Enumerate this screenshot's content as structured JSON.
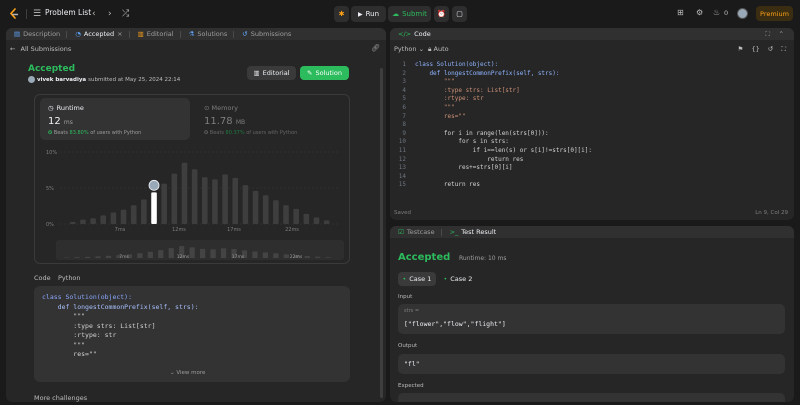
{
  "header": {
    "problem_list": "Problem List",
    "run": "Run",
    "submit": "Submit",
    "streak": "0",
    "premium": "Premium"
  },
  "left_tabs": [
    {
      "label": "Description"
    },
    {
      "label": "Accepted"
    },
    {
      "label": "Editorial"
    },
    {
      "label": "Solutions"
    },
    {
      "label": "Submissions"
    }
  ],
  "submission": {
    "back": "All Submissions",
    "status": "Accepted",
    "user": "vivek barvadiya",
    "submitted_at": "submitted at May 25, 2024 22:14",
    "editorial_btn": "Editorial",
    "solution_btn": "Solution"
  },
  "runtime": {
    "label": "Runtime",
    "value": "12",
    "unit": "ms",
    "beats_prefix": "Beats",
    "beats_pct": "83.80%",
    "beats_suffix": "of users with Python"
  },
  "memory": {
    "label": "Memory",
    "value": "11.78",
    "unit": "MB",
    "beats_prefix": "Beats",
    "beats_pct": "80.37%",
    "beats_suffix": "of users with Python"
  },
  "chart_data": {
    "type": "bar",
    "y_ticks": [
      "10%",
      "5%",
      "0%"
    ],
    "ylim": [
      0,
      10
    ],
    "x_ticks": [
      "7ms",
      "12ms",
      "17ms",
      "22ms"
    ],
    "mini_x_ticks": [
      "7ms",
      "12ms",
      "17ms",
      "22ms"
    ],
    "values": [
      0.3,
      0.6,
      0.8,
      1.2,
      1.6,
      2.0,
      2.6,
      3.4,
      4.4,
      5.6,
      7.0,
      8.5,
      7.6,
      6.5,
      6.2,
      6.9,
      6.4,
      5.4,
      4.6,
      4.0,
      3.3,
      2.6,
      2.1,
      1.4,
      0.9,
      0.5
    ],
    "highlight_index": 8
  },
  "code_view": {
    "code_label": "Code",
    "lang": "Python",
    "lines": [
      "class Solution(object):",
      "    def longestCommonPrefix(self, strs):",
      "        \"\"\"",
      "        :type strs: List[str]",
      "        :rtype: str",
      "        \"\"\"",
      "        res=\"\""
    ],
    "view_more": "View more",
    "more_challenges": "More challenges"
  },
  "code_panel": {
    "title": "Code",
    "lang": "Python",
    "auto": "Auto",
    "saved": "Saved",
    "cursor": "Ln 9, Col 29"
  },
  "editor_lines": [
    {
      "n": "1",
      "text": "class Solution(object):"
    },
    {
      "n": "2",
      "text": "    def longestCommonPrefix(self, strs):"
    },
    {
      "n": "3",
      "text": "        \"\"\""
    },
    {
      "n": "4",
      "text": "        :type strs: List[str]"
    },
    {
      "n": "5",
      "text": "        :rtype: str"
    },
    {
      "n": "6",
      "text": "        \"\"\""
    },
    {
      "n": "7",
      "text": "        res=\"\""
    },
    {
      "n": "8",
      "text": ""
    },
    {
      "n": "9",
      "text": "        for i in range(len(strs[0])):"
    },
    {
      "n": "10",
      "text": "            for s in strs:"
    },
    {
      "n": "11",
      "text": "                if i==len(s) or s[i]!=strs[0][i]:"
    },
    {
      "n": "12",
      "text": "                    return res"
    },
    {
      "n": "13",
      "text": "            res+=strs[0][i]"
    },
    {
      "n": "14",
      "text": ""
    },
    {
      "n": "15",
      "text": "        return res"
    }
  ],
  "result": {
    "testcase_tab": "Testcase",
    "result_tab": "Test Result",
    "status": "Accepted",
    "runtime": "Runtime: 10 ms",
    "case1": "Case 1",
    "case2": "Case 2",
    "input_label": "Input",
    "input_var": "strs =",
    "input_value": "[\"flower\",\"flow\",\"flight\"]",
    "output_label": "Output",
    "output_value": "\"fl\"",
    "expected_label": "Expected"
  },
  "colors": {
    "accent_green": "#2cbb5d",
    "premium_orange": "#ffa116",
    "panel_bg": "#262626",
    "bar": "#3e3e3e",
    "bar_highlight": "#ffffff"
  }
}
